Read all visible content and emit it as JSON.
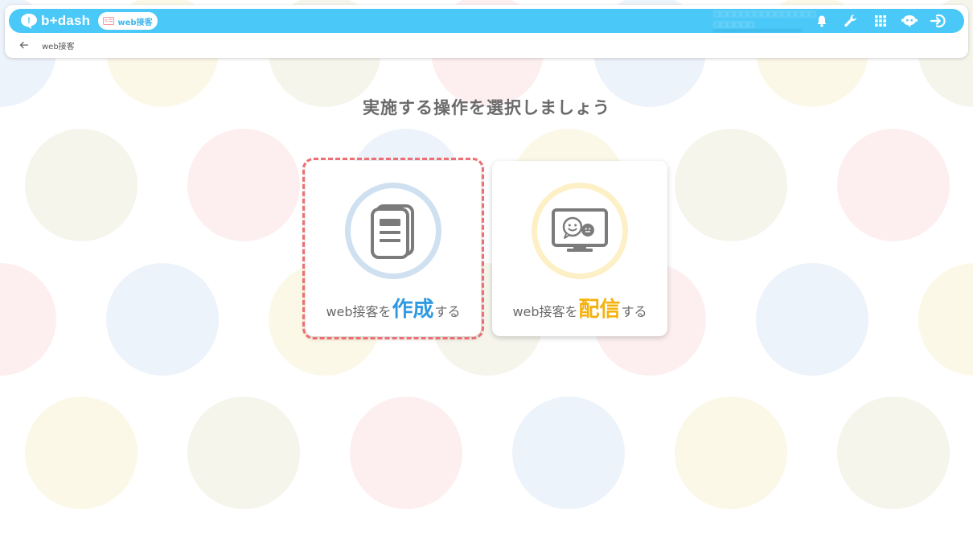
{
  "header": {
    "logo_text": "b+dash",
    "module_label": "web接客",
    "icons": [
      "bell-icon",
      "wrench-icon",
      "grid-icon",
      "chat-robot-icon",
      "logout-icon"
    ]
  },
  "breadcrumb": {
    "back_icon": "arrow-left-icon",
    "label": "web接客"
  },
  "main": {
    "title": "実施する操作を選択しましょう",
    "cards": [
      {
        "pre": "web接客を",
        "emphasis": "作成",
        "post": "する",
        "icon": "document-icon",
        "accent": "#2f9ae2",
        "selected": true
      },
      {
        "pre": "web接客を",
        "emphasis": "配信",
        "post": "する",
        "icon": "monitor-chat-icon",
        "accent": "#f5b10d",
        "selected": false
      }
    ]
  },
  "colors": {
    "topbar": "#4ac8f7",
    "selected_outline": "#ee6f73"
  }
}
